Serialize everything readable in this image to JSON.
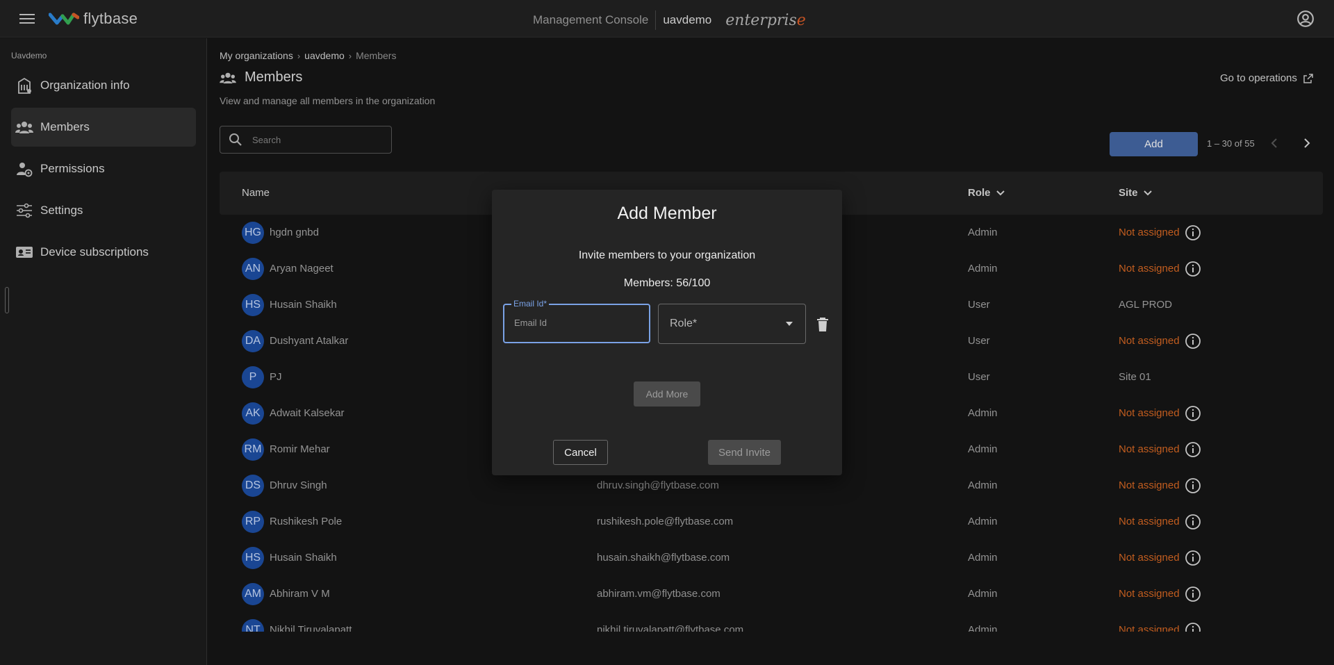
{
  "header": {
    "logo_text": "flytbase",
    "console_label": "Management Console",
    "org_name": "uavdemo",
    "plan_prefix": "enterpris",
    "plan_suffix": "e"
  },
  "sidebar": {
    "org_label": "Uavdemo",
    "items": [
      {
        "label": "Organization info",
        "icon": "building-icon",
        "active": false
      },
      {
        "label": "Members",
        "icon": "people-icon",
        "active": true
      },
      {
        "label": "Permissions",
        "icon": "user-lock-icon",
        "active": false
      },
      {
        "label": "Settings",
        "icon": "sliders-icon",
        "active": false
      },
      {
        "label": "Device subscriptions",
        "icon": "id-card-icon",
        "active": false
      }
    ]
  },
  "breadcrumb": [
    "My organizations",
    "uavdemo",
    "Members"
  ],
  "page": {
    "title": "Members",
    "subtitle": "View and manage all members in the organization",
    "goto_operations": "Go to operations"
  },
  "search": {
    "placeholder": "Search",
    "value": ""
  },
  "toolbar": {
    "add_label": "Add",
    "pager_text": "1 – 30 of 55"
  },
  "table": {
    "columns": {
      "name": "Name",
      "role": "Role",
      "site": "Site"
    },
    "rows": [
      {
        "initials": "HG",
        "name": "hgdn gnbd",
        "email": "",
        "role": "Admin",
        "site": "Not assigned",
        "site_assigned": false
      },
      {
        "initials": "AN",
        "name": "Aryan Nageet",
        "email": "",
        "role": "Admin",
        "site": "Not assigned",
        "site_assigned": false
      },
      {
        "initials": "HS",
        "name": "Husain Shaikh",
        "email": "",
        "role": "User",
        "site": "AGL PROD",
        "site_assigned": true
      },
      {
        "initials": "DA",
        "name": "Dushyant Atalkar",
        "email": "",
        "role": "User",
        "site": "Not assigned",
        "site_assigned": false
      },
      {
        "initials": "P",
        "name": "PJ",
        "email": "",
        "role": "User",
        "site": "Site 01",
        "site_assigned": true
      },
      {
        "initials": "AK",
        "name": "Adwait Kalsekar",
        "email": "",
        "role": "Admin",
        "site": "Not assigned",
        "site_assigned": false
      },
      {
        "initials": "RM",
        "name": "Romir Mehar",
        "email": "",
        "role": "Admin",
        "site": "Not assigned",
        "site_assigned": false
      },
      {
        "initials": "DS",
        "name": "Dhruv Singh",
        "email": "dhruv.singh@flytbase.com",
        "role": "Admin",
        "site": "Not assigned",
        "site_assigned": false
      },
      {
        "initials": "RP",
        "name": "Rushikesh Pole",
        "email": "rushikesh.pole@flytbase.com",
        "role": "Admin",
        "site": "Not assigned",
        "site_assigned": false
      },
      {
        "initials": "HS",
        "name": "Husain Shaikh",
        "email": "husain.shaikh@flytbase.com",
        "role": "Admin",
        "site": "Not assigned",
        "site_assigned": false
      },
      {
        "initials": "AM",
        "name": "Abhiram V M",
        "email": "abhiram.vm@flytbase.com",
        "role": "Admin",
        "site": "Not assigned",
        "site_assigned": false
      },
      {
        "initials": "NT",
        "name": "Nikhil Tiruvalapatt",
        "email": "nikhil.tiruvalapatt@flytbase.com",
        "role": "Admin",
        "site": "Not assigned",
        "site_assigned": false
      }
    ]
  },
  "modal": {
    "title": "Add Member",
    "subtitle": "Invite members to your organization",
    "members_count": "Members: 56/100",
    "email_label": "Email Id*",
    "email_placeholder": "Email Id",
    "email_value": "",
    "role_placeholder": "Role*",
    "add_more_label": "Add More",
    "cancel_label": "Cancel",
    "send_label": "Send Invite"
  },
  "colors": {
    "accent": "#4669a8",
    "not_assigned": "#dd6a24",
    "avatar": "#1e50a8",
    "focus": "#7aa2e6"
  }
}
